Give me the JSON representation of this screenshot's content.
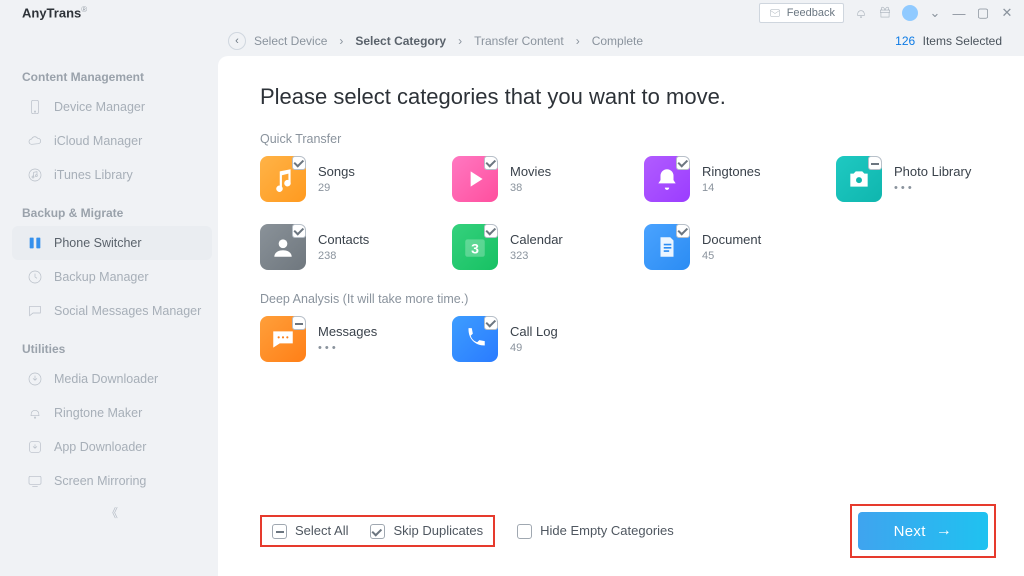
{
  "brand": "AnyTrans",
  "titlebar": {
    "feedback": "Feedback"
  },
  "breadcrumb": {
    "steps": [
      "Select Device",
      "Select Category",
      "Transfer Content",
      "Complete"
    ],
    "active_index": 1
  },
  "selection_summary": {
    "count": "126",
    "suffix": "Items Selected"
  },
  "sidebar": {
    "group_content": "Content Management",
    "group_backup": "Backup & Migrate",
    "group_util": "Utilities",
    "items": {
      "device_manager": "Device Manager",
      "icloud_manager": "iCloud Manager",
      "itunes_library": "iTunes Library",
      "phone_switcher": "Phone Switcher",
      "backup_manager": "Backup Manager",
      "social_messages": "Social Messages Manager",
      "media_downloader": "Media Downloader",
      "ringtone_maker": "Ringtone Maker",
      "app_downloader": "App Downloader",
      "screen_mirroring": "Screen Mirroring"
    }
  },
  "main": {
    "heading": "Please select categories that you want to move.",
    "section_quick": "Quick Transfer",
    "section_deep": "Deep Analysis (It will take more time.)",
    "categories": {
      "songs": {
        "label": "Songs",
        "count": "29"
      },
      "movies": {
        "label": "Movies",
        "count": "38"
      },
      "ringtones": {
        "label": "Ringtones",
        "count": "14"
      },
      "photo": {
        "label": "Photo Library",
        "count": "• • •"
      },
      "contacts": {
        "label": "Contacts",
        "count": "238"
      },
      "calendar": {
        "label": "Calendar",
        "count": "323"
      },
      "document": {
        "label": "Document",
        "count": "45"
      },
      "messages": {
        "label": "Messages",
        "count": "• • •"
      },
      "calllog": {
        "label": "Call Log",
        "count": "49"
      }
    },
    "bottom": {
      "select_all": "Select All",
      "skip_dup": "Skip Duplicates",
      "hide_empty": "Hide Empty Categories",
      "next": "Next"
    }
  }
}
